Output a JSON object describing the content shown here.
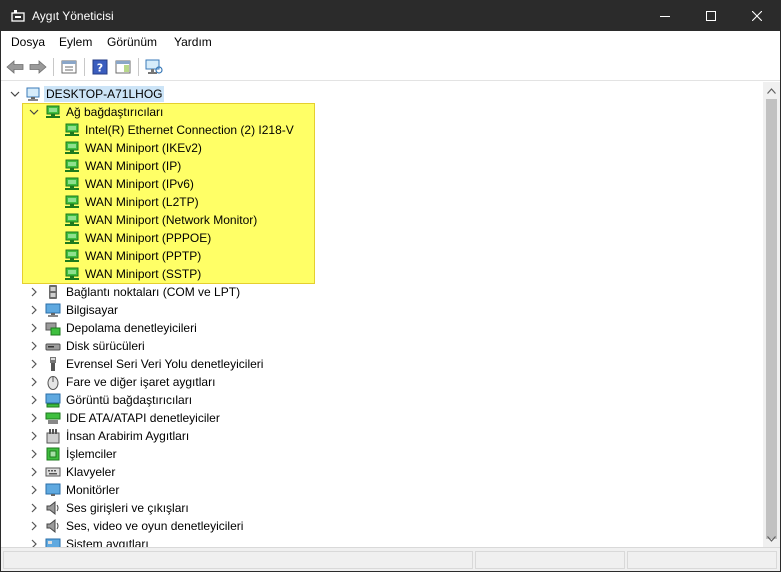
{
  "window": {
    "title": "Aygıt Yöneticisi"
  },
  "menu": [
    "Dosya",
    "Eylem",
    "Görünüm",
    "Yardım"
  ],
  "tree": {
    "root": "DESKTOP-A71LHOG",
    "expanded_category": {
      "label": "Ağ bağdaştırıcıları",
      "children": [
        "Intel(R) Ethernet Connection (2) I218-V",
        "WAN Miniport (IKEv2)",
        "WAN Miniport (IP)",
        "WAN Miniport (IPv6)",
        "WAN Miniport (L2TP)",
        "WAN Miniport (Network Monitor)",
        "WAN Miniport (PPPOE)",
        "WAN Miniport (PPTP)",
        "WAN Miniport (SSTP)"
      ]
    },
    "categories": [
      {
        "label": "Bağlantı noktaları (COM ve LPT)",
        "icon": "port-icon"
      },
      {
        "label": "Bilgisayar",
        "icon": "computer-icon"
      },
      {
        "label": "Depolama denetleyicileri",
        "icon": "storage-controller-icon"
      },
      {
        "label": "Disk sürücüleri",
        "icon": "disk-drive-icon"
      },
      {
        "label": "Evrensel Seri Veri Yolu denetleyicileri",
        "icon": "usb-icon"
      },
      {
        "label": "Fare ve diğer işaret aygıtları",
        "icon": "mouse-icon"
      },
      {
        "label": "Görüntü bağdaştırıcıları",
        "icon": "display-adapter-icon"
      },
      {
        "label": "IDE ATA/ATAPI denetleyiciler",
        "icon": "ide-icon"
      },
      {
        "label": "İnsan Arabirim Aygıtları",
        "icon": "hid-icon"
      },
      {
        "label": "İşlemciler",
        "icon": "processor-icon"
      },
      {
        "label": "Klavyeler",
        "icon": "keyboard-icon"
      },
      {
        "label": "Monitörler",
        "icon": "monitor-icon"
      },
      {
        "label": "Ses girişleri ve çıkışları",
        "icon": "speaker-icon"
      },
      {
        "label": "Ses, video ve oyun denetleyicileri",
        "icon": "sound-controller-icon"
      },
      {
        "label": "Sistem aygıtları",
        "icon": "system-devices-icon"
      }
    ]
  },
  "colors": {
    "titlebar": "#2b2b2b",
    "highlight": "#ffff66",
    "selection": "#cce4f7",
    "network": "#3fbf3f"
  }
}
